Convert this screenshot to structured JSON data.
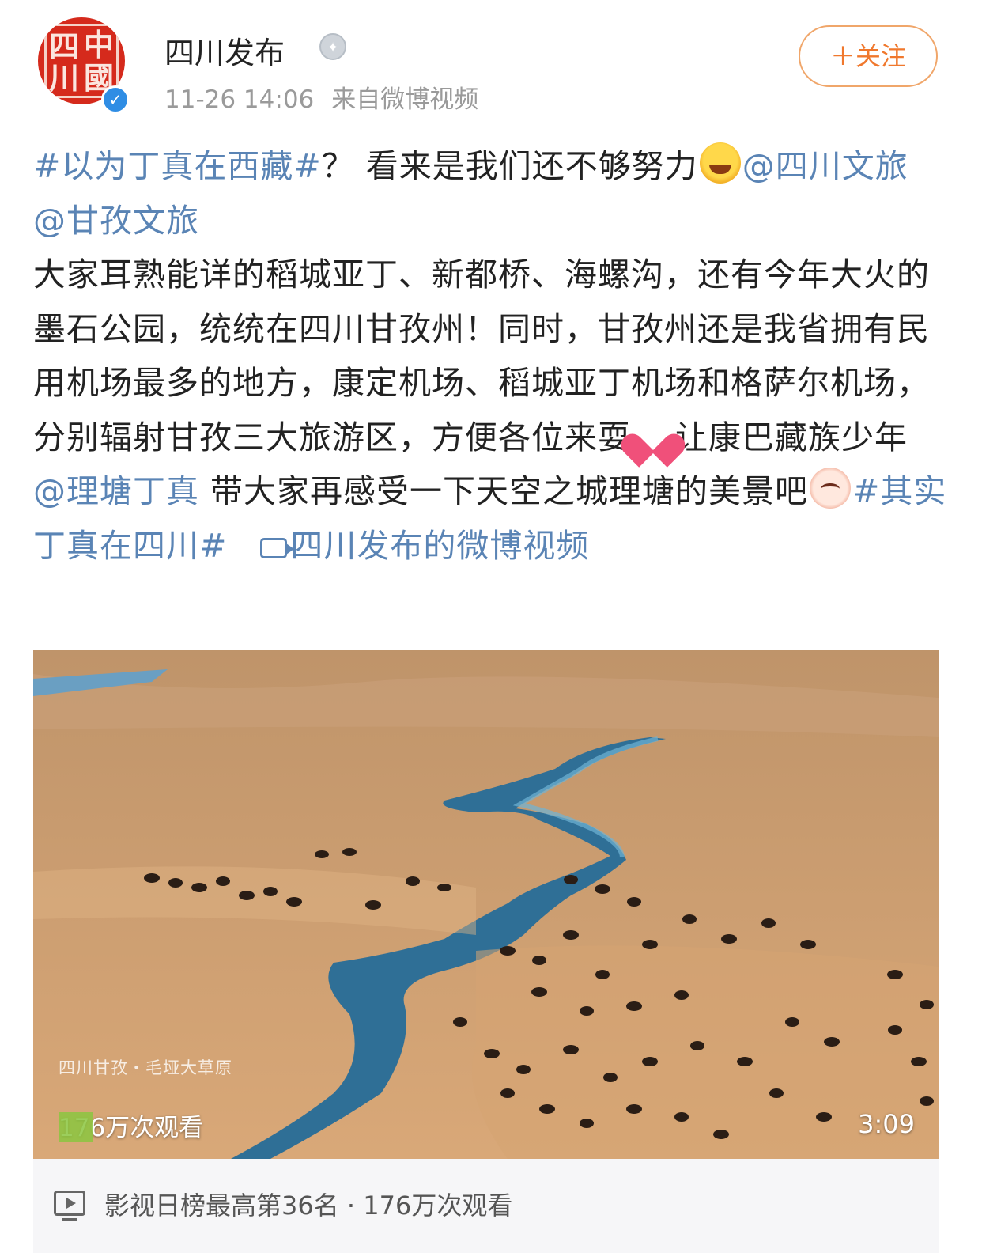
{
  "header": {
    "avatar_icon": "seal-avatar",
    "username": "四川发布",
    "medal_label": "відзнака",
    "timestamp": "11-26 14:06",
    "source": "来自微博视频",
    "follow_label": "＋关注"
  },
  "post": {
    "hashtag1": "#以为丁真在西藏#",
    "text1": "？ 看来是我们还不够努力",
    "mention1": "@四川文旅",
    "mention2": "@甘孜文旅",
    "text2": "大家耳熟能详的稻城亚丁、新都桥、海螺沟，还有今年大火的墨石公园，统统在四川甘孜州！同时，甘孜州还是我省拥有民用机场最多的地方，康定机场、稻城亚丁机场和格萨尔机场，分别辐射甘孜三大旅游区，方便各位来耍",
    "text3": "让康巴藏族少年",
    "mention3": "@理塘丁真",
    "text4": "带大家再感受一下天空之城理塘的美景吧",
    "hashtag2": "#其实丁真在四川#",
    "video_link": "四川发布的微博视频"
  },
  "video": {
    "caption": "四川甘孜・毛垭大草原",
    "views": "176万次观看",
    "duration": "3:09"
  },
  "rank_bar": {
    "text": "影视日榜最高第36名 · 176万次观看"
  },
  "colors": {
    "link": "#5a84b5",
    "follow": "#f0782d",
    "meta": "#9a9a9a"
  }
}
